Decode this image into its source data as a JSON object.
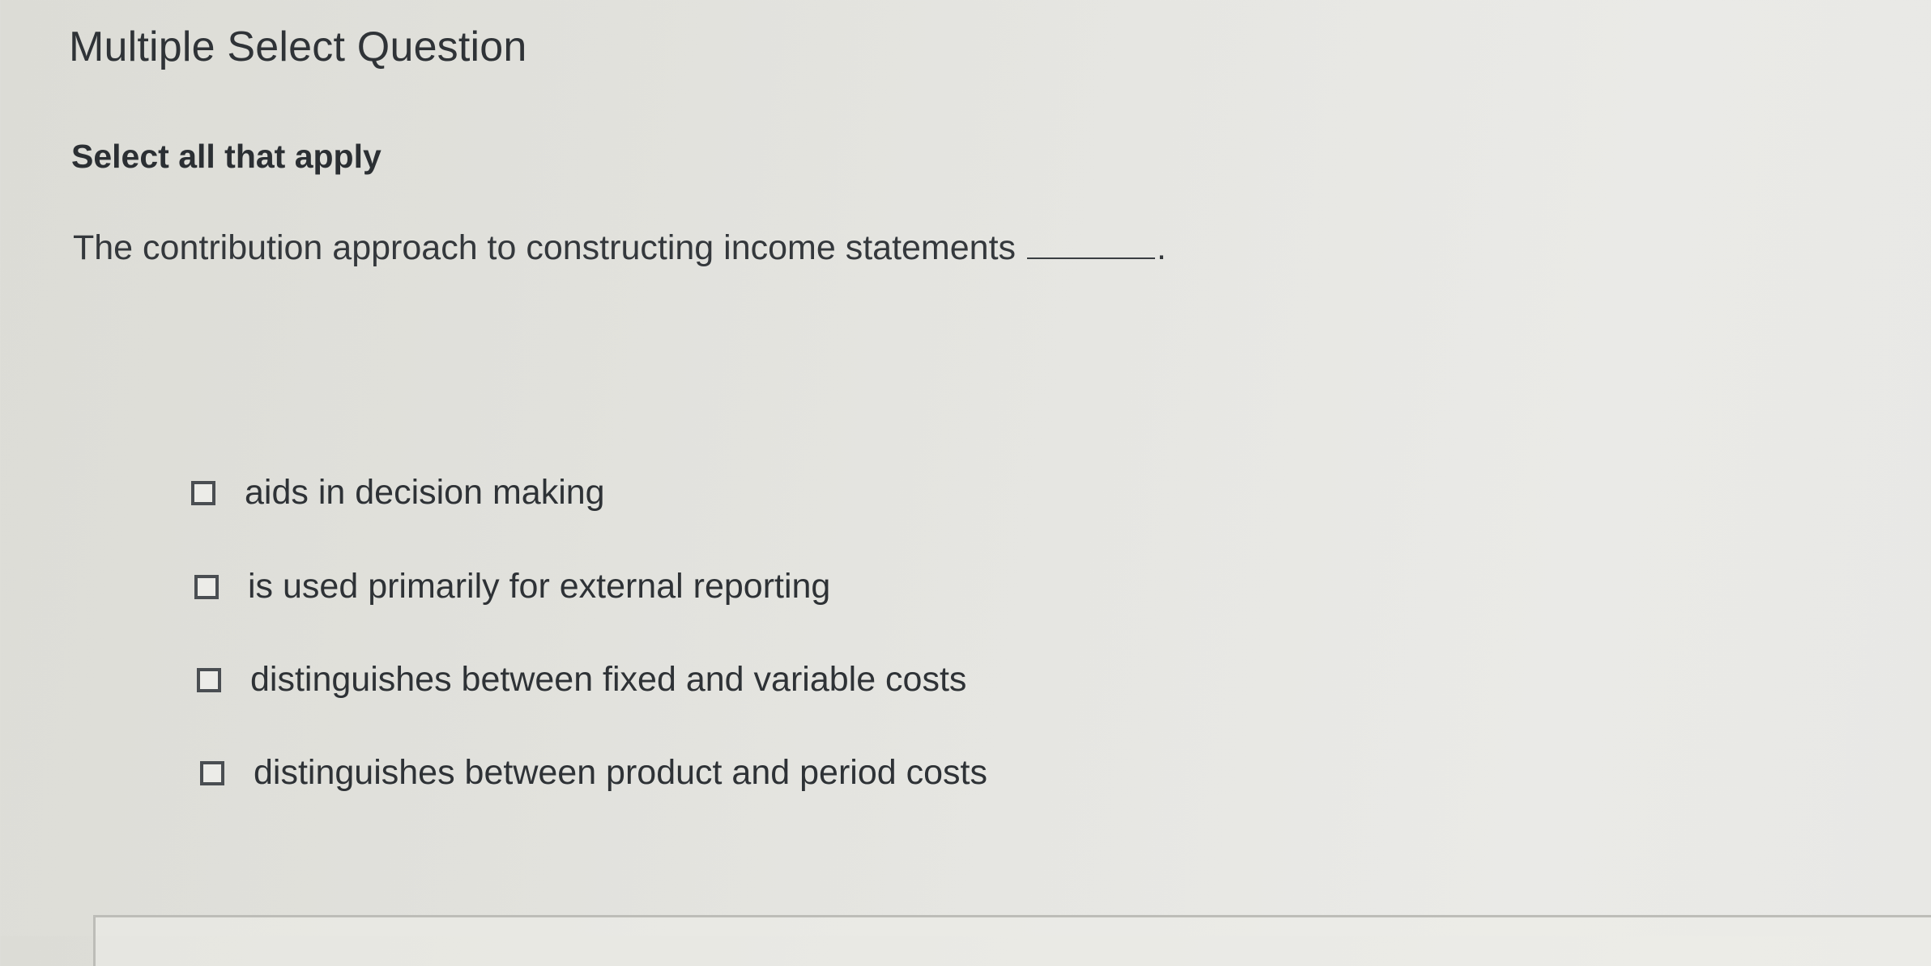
{
  "header": {
    "title": "Multiple Select Question"
  },
  "instruction": "Select all that apply",
  "question": {
    "text": "The contribution approach to constructing income statements",
    "terminator": "."
  },
  "options": [
    {
      "label": "aids in decision making",
      "checked": false
    },
    {
      "label": "is used primarily for external reporting",
      "checked": false
    },
    {
      "label": "distinguishes between fixed and variable costs",
      "checked": false
    },
    {
      "label": "distinguishes between product and period costs",
      "checked": false
    }
  ]
}
